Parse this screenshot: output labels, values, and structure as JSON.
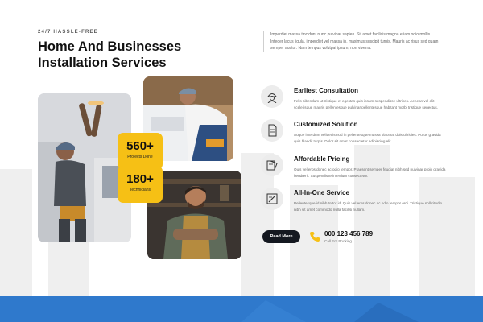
{
  "header": {
    "eyebrow": "24/7 HASSLE-FREE",
    "title": "Home And Businesses Installation Services"
  },
  "intro": {
    "text": "Imperdiet massa tincidunt nunc pulvinar sapien. Sit amet facilisis magna etiam odio mollis. Integer lacus ligula, imperdiet vel massa in, maximus suscipit turpis. Mauris ac risus sed quam semper auctor. Nam tempus volutpat ipsum, non viverra."
  },
  "stats": [
    {
      "value": "560+",
      "label": "Projects Done"
    },
    {
      "value": "180+",
      "label": "Technicians"
    }
  ],
  "features": [
    {
      "icon": "worker-helmet-icon",
      "title": "Earliest Consultation",
      "desc": "Felis bibendum ut tristique et egestas quis ipsum suspendisse ultrices. Aenean vel elit scelerisque mauris pellentesque pulvinar pellentesque habitant morbi tristique senectus."
    },
    {
      "icon": "document-icon",
      "title": "Customized Solution",
      "desc": "Augue interdum velit euismod in pellentesque massa placerat duis ultricies. Purus gravida quis blandit turpis. Dolor sit amet consectetur adipiscing elit."
    },
    {
      "icon": "pricing-swatch-icon",
      "title": "Affordable Pricing",
      "desc": "Quis vel eros donec ac odio tempor. Praesent semper feugiat nibh sed pulvinar proin gravida hendrerit. Suspendisse interdum consectetur."
    },
    {
      "icon": "tools-icon",
      "title": "All-In-One Service",
      "desc": "Pellentesque id nibh tortor id. Quis vel eros donec ac odio tempor orci. Tristique sollicitudin nibh sit amet commodo nulla facilisi nullam."
    }
  ],
  "cta": {
    "button_label": "Read More",
    "phone_number": "000 123 456 789",
    "phone_label": "Call For Booking"
  },
  "colors": {
    "accent_yellow": "#f6c015",
    "dark": "#141820",
    "band_blue": "#2f79cc"
  }
}
